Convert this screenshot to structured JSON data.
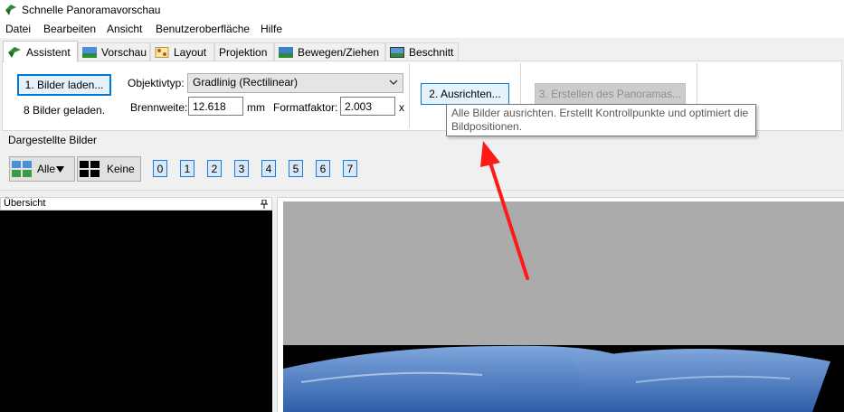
{
  "window": {
    "title": "Schnelle Panoramavorschau"
  },
  "menu": [
    "Datei",
    "Bearbeiten",
    "Ansicht",
    "Benutzeroberfläche",
    "Hilfe"
  ],
  "tabs": [
    {
      "label": "Assistent",
      "active": true
    },
    {
      "label": "Vorschau"
    },
    {
      "label": "Layout"
    },
    {
      "label": "Projektion"
    },
    {
      "label": "Bewegen/Ziehen"
    },
    {
      "label": "Beschnitt"
    }
  ],
  "wizard": {
    "load_button": "1. Bilder laden...",
    "loaded_status": "8 Bilder geladen.",
    "lens_type_label": "Objektivtyp:",
    "lens_type_value": "Gradlinig (Rectilinear)",
    "focal_length_label": "Brennweite:",
    "focal_length_value": "12.618",
    "focal_length_unit": "mm",
    "crop_factor_label": "Formatfaktor:",
    "crop_factor_value": "2.003",
    "crop_factor_unit": "x",
    "align_button": "2. Ausrichten...",
    "create_button": "3. Erstellen des Panoramas..."
  },
  "tooltip": {
    "text": "Alle Bilder ausrichten. Erstellt Kontrollpunkte und optimiert die Bildpositionen."
  },
  "displayed": {
    "title": "Dargestellte Bilder",
    "all_label": "Alle",
    "none_label": "Keine",
    "images": [
      "0",
      "1",
      "2",
      "3",
      "4",
      "5",
      "6",
      "7"
    ]
  },
  "overview": {
    "title": "Übersicht"
  },
  "colors": {
    "accent": "#0078d7",
    "arrow": "#ff1a1a",
    "sky": "#5b87c9",
    "preview_bg": "#ababab"
  }
}
